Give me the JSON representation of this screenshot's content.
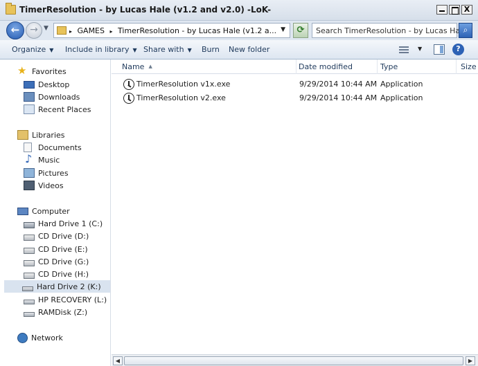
{
  "window": {
    "title": "TimerResolution - by Lucas Hale (v1.2 and v2.0) -LoK-"
  },
  "window_buttons": {
    "minimize": "_",
    "maximize": "□",
    "close": "X"
  },
  "address": {
    "crumb_root": "GAMES",
    "crumb_current": "TimerResolution - by Lucas Hale (v1.2 a..."
  },
  "search": {
    "placeholder": "Search TimerResolution - by Lucas Ha..."
  },
  "toolbar": {
    "organize": "Organize",
    "include_in_library": "Include in library",
    "share_with": "Share with",
    "burn": "Burn",
    "new_folder": "New folder"
  },
  "sidebar": {
    "favorites": {
      "label": "Favorites",
      "items": [
        {
          "label": "Desktop",
          "icon": "desktop-icon"
        },
        {
          "label": "Downloads",
          "icon": "downloads-icon"
        },
        {
          "label": "Recent Places",
          "icon": "recent-places-icon"
        }
      ]
    },
    "libraries": {
      "label": "Libraries",
      "items": [
        {
          "label": "Documents",
          "icon": "documents-icon"
        },
        {
          "label": "Music",
          "icon": "music-icon"
        },
        {
          "label": "Pictures",
          "icon": "pictures-icon"
        },
        {
          "label": "Videos",
          "icon": "videos-icon"
        }
      ]
    },
    "computer": {
      "label": "Computer",
      "items": [
        {
          "label": "Hard Drive 1 (C:)",
          "icon": "hard-drive-icon"
        },
        {
          "label": "CD Drive (D:)",
          "icon": "cd-drive-icon"
        },
        {
          "label": "CD Drive (E:)",
          "icon": "cd-drive-icon"
        },
        {
          "label": "CD Drive (G:)",
          "icon": "cd-drive-icon"
        },
        {
          "label": "CD Drive (H:)",
          "icon": "cd-drive-icon"
        },
        {
          "label": "Hard Drive 2 (K:)",
          "icon": "hard-drive-icon",
          "selected": true
        },
        {
          "label": "HP RECOVERY (L:)",
          "icon": "hard-drive-icon"
        },
        {
          "label": "RAMDisk (Z:)",
          "icon": "hard-drive-icon"
        }
      ]
    },
    "network": {
      "label": "Network"
    }
  },
  "columns": {
    "name": "Name",
    "date_modified": "Date modified",
    "type": "Type",
    "size": "Size"
  },
  "files": [
    {
      "name": "TimerResolution v1x.exe",
      "date": "9/29/2014 10:44 AM",
      "type": "Application"
    },
    {
      "name": "TimerResolution v2.exe",
      "date": "9/29/2014 10:44 AM",
      "type": "Application"
    }
  ]
}
